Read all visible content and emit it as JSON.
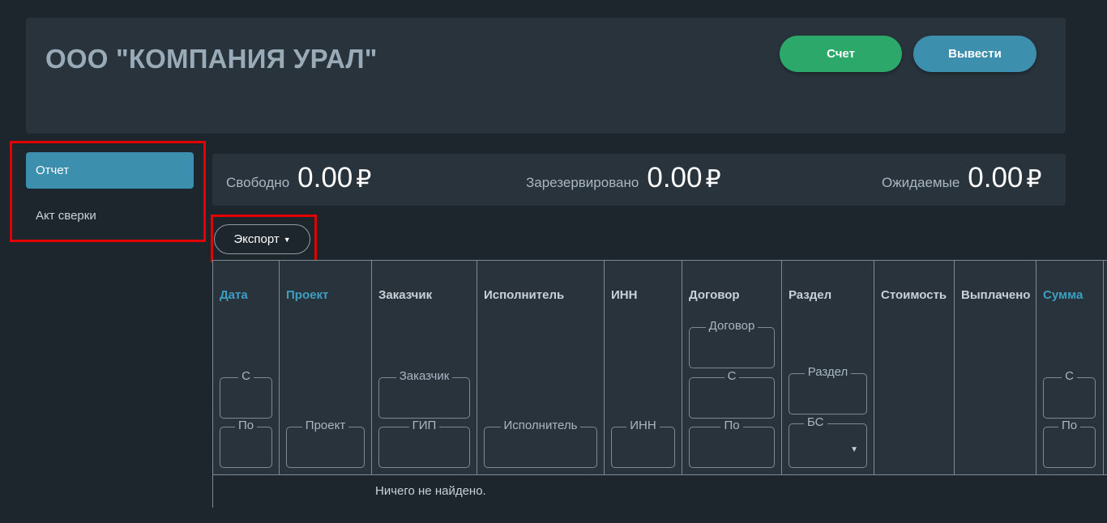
{
  "header": {
    "company_name": "ООО \"КОМПАНИЯ УРАЛ\"",
    "invoice_button": "Счет",
    "withdraw_button": "Вывести"
  },
  "sidebar": {
    "items": [
      {
        "label": "Отчет",
        "active": true
      },
      {
        "label": "Акт сверки",
        "active": false
      }
    ]
  },
  "balances": {
    "currency": "₽",
    "free": {
      "label": "Свободно",
      "value": "0.00"
    },
    "reserved": {
      "label": "Зарезервировано",
      "value": "0.00"
    },
    "expected": {
      "label": "Ожидаемые",
      "value": "0.00"
    }
  },
  "toolbar": {
    "export_label": "Экспорт",
    "caret": "▼"
  },
  "table": {
    "columns": {
      "date": "Дата",
      "project": "Проект",
      "customer": "Заказчик",
      "executor": "Исполнитель",
      "inn": "ИНН",
      "contract": "Договор",
      "section": "Раздел",
      "cost": "Стоимость",
      "paid": "Выплачено",
      "sum": "Сумма"
    },
    "filters": {
      "date_from": "С",
      "date_to": "По",
      "project": "Проект",
      "customer": "Заказчик",
      "gip": "ГИП",
      "executor": "Исполнитель",
      "inn": "ИНН",
      "contract": "Договор",
      "contract_from": "С",
      "contract_to": "По",
      "section": "Раздел",
      "bs": "БС",
      "sum_from": "С",
      "sum_to": "По"
    },
    "dropdown_caret": "▼",
    "empty_message": "Ничего не найдено."
  },
  "colors": {
    "background": "#1e262d",
    "card": "#29333c",
    "accent_blue": "#3d8fae",
    "accent_green": "#2ca96a",
    "highlight_red": "#e50000",
    "sortable_header": "#3d9ec1"
  }
}
